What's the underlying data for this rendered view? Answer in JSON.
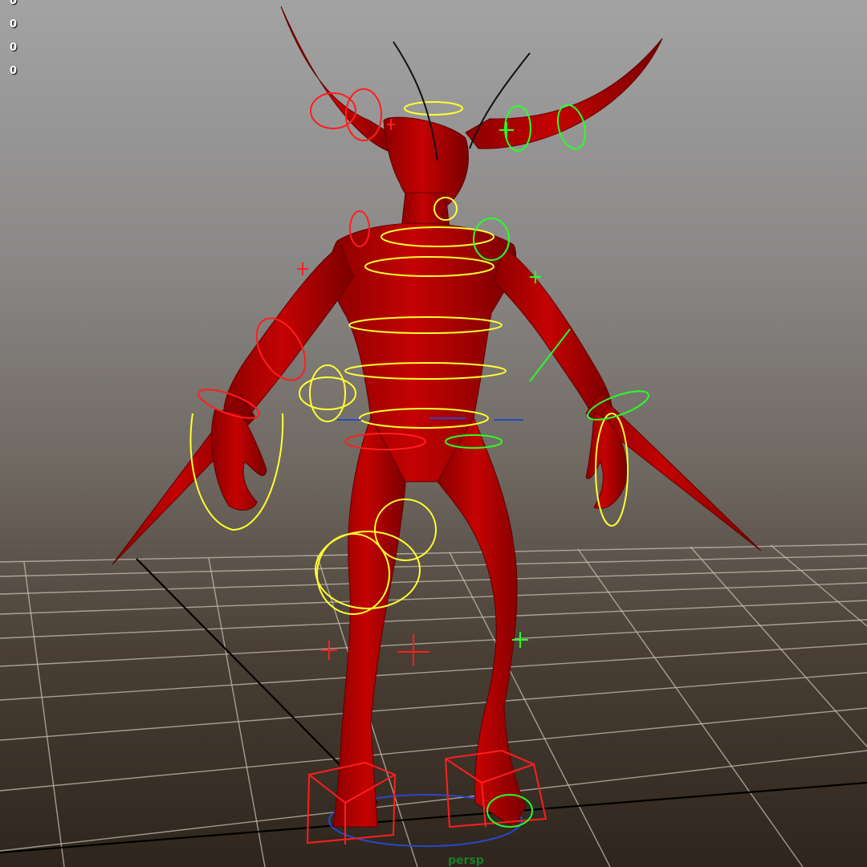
{
  "viewport": {
    "camera_label": "persp",
    "hud_values": [
      "0",
      "0",
      "0",
      "0"
    ]
  },
  "colors": {
    "model": "#b00000",
    "control_selected": "#ff1e1e",
    "control_ik": "#ffff32",
    "control_left": "#28ff28",
    "grid": "#c8c0b4",
    "grid_axis": "#000000",
    "world_ctrl": "#2848c8"
  },
  "controls": {
    "fk_yellow": "yellow-control",
    "left_green": "green-control",
    "right_red": "red-control"
  }
}
